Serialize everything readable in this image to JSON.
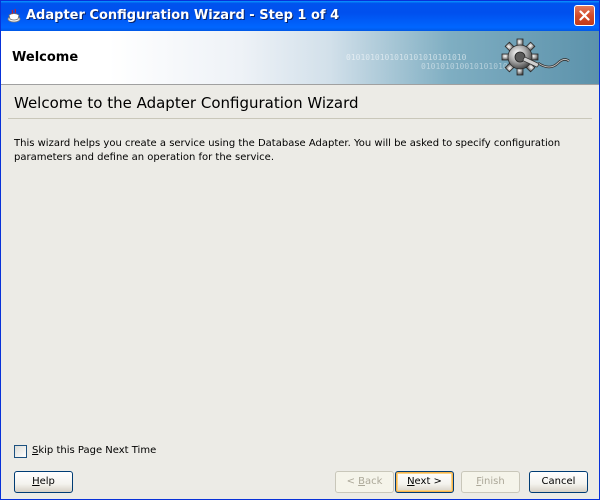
{
  "window": {
    "title": "Adapter Configuration Wizard - Step 1 of 4"
  },
  "banner": {
    "title": "Welcome",
    "binary_text_1": "0101010101010101010101010",
    "binary_text_2": "010101010010101010"
  },
  "main": {
    "heading": "Welcome to the Adapter Configuration Wizard",
    "description": "This wizard helps you create a service using the Database Adapter. You will be asked to specify configuration parameters and define an operation for the service."
  },
  "skip": {
    "checked": false,
    "label_prefix": "S",
    "label_rest": "kip this Page Next Time"
  },
  "buttons": {
    "help": {
      "mnemonic": "H",
      "rest": "elp"
    },
    "back": {
      "prefix": "< ",
      "mnemonic": "B",
      "rest": "ack",
      "enabled": false
    },
    "next": {
      "mnemonic": "N",
      "rest": "ext >",
      "enabled": true
    },
    "finish": {
      "mnemonic": "F",
      "rest": "inish",
      "enabled": false
    },
    "cancel": {
      "label": "Cancel"
    }
  },
  "colors": {
    "titlebar": "#0058e6",
    "close_button": "#d44b2a",
    "content_bg": "#ecebe6"
  }
}
